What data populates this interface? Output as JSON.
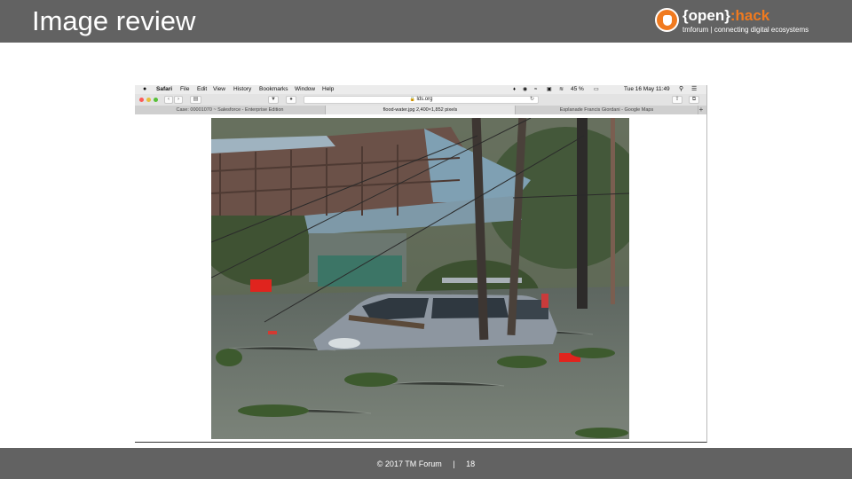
{
  "slide": {
    "title": "Image review",
    "footer": {
      "copyright": "© 2017 TM Forum",
      "separator": "|",
      "page_number": "18"
    }
  },
  "brand": {
    "name_part1": "{open}",
    "name_part2": ":hack",
    "tagline": "tmforum | connecting digital ecosystems",
    "logo_icon": "open-hand-icon"
  },
  "browser": {
    "menubar": {
      "apple_icon": "apple-icon",
      "app_name": "Safari",
      "items": [
        "File",
        "Edit",
        "View",
        "History",
        "Bookmarks",
        "Window",
        "Help"
      ],
      "battery": "45 %",
      "datetime": "Tue 16 May  11:49"
    },
    "address": "lds.org",
    "tabs": [
      {
        "label": "Case: 00001070 ~ Salesforce - Enterprise Edition",
        "active": false
      },
      {
        "label": "flood-water.jpg 2,400×1,852 pixels",
        "active": true
      },
      {
        "label": "Esplanade Francis Giordani - Google Maps",
        "active": false
      }
    ],
    "new_tab": "+"
  },
  "colors": {
    "header_bg": "#626262",
    "accent": "#f07a1f"
  }
}
